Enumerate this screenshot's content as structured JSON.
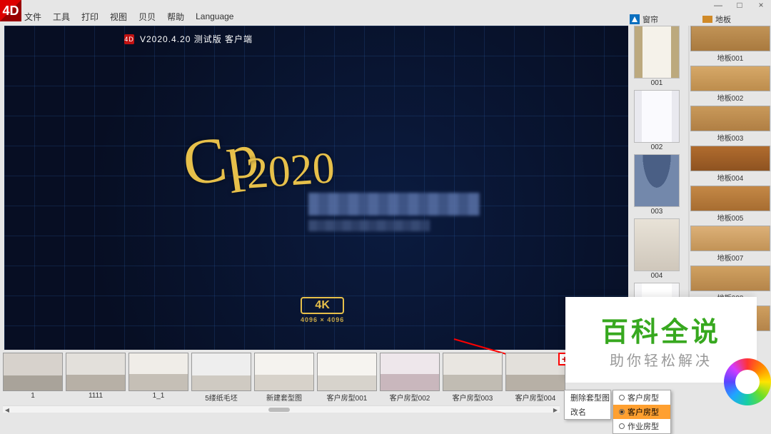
{
  "window": {
    "min": "—",
    "restore": "□",
    "close": "×"
  },
  "menu": {
    "items": [
      "文件",
      "工具",
      "打印",
      "视图",
      "贝贝",
      "帮助",
      "Language"
    ]
  },
  "splash": {
    "version_line": "V2020.4.20 测试版 客户端",
    "badge_4k": "4K",
    "badge_res": "4096 × 4096"
  },
  "curtain_panel": {
    "title": "窗帘",
    "items": [
      {
        "label": "001"
      },
      {
        "label": "002"
      },
      {
        "label": "003"
      },
      {
        "label": "004"
      },
      {
        "label": ""
      }
    ]
  },
  "floor_panel": {
    "title": "地板",
    "items": [
      {
        "label": "地板001"
      },
      {
        "label": "地板002"
      },
      {
        "label": "地板003"
      },
      {
        "label": "地板004"
      },
      {
        "label": "地板005"
      },
      {
        "label": "地板007"
      },
      {
        "label": "地板008"
      },
      {
        "label": ""
      }
    ]
  },
  "thumbs": [
    {
      "label": "1"
    },
    {
      "label": "1111"
    },
    {
      "label": "1_1"
    },
    {
      "label": "5缕纸毛坯"
    },
    {
      "label": "新建套型图"
    },
    {
      "label": "客户房型001"
    },
    {
      "label": "客户房型002"
    },
    {
      "label": "客户房型003"
    },
    {
      "label": "客户房型004"
    }
  ],
  "context_menu": {
    "item1": "删除套型图",
    "item2": "改名"
  },
  "roomtype_menu": {
    "opt1": "客户房型",
    "opt2": "客户房型",
    "opt3": "作业房型"
  },
  "watermark": {
    "big": "百科全说",
    "small": "助你轻松解决"
  },
  "add_button": "+"
}
